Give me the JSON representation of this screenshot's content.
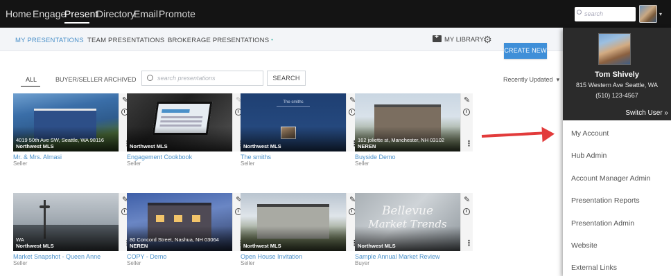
{
  "topnav": {
    "items": [
      {
        "label": "Home"
      },
      {
        "label": "Engage"
      },
      {
        "label": "Present"
      },
      {
        "label": "Directory"
      },
      {
        "label": "Email"
      },
      {
        "label": "Promote"
      }
    ],
    "active": "Present",
    "search_placeholder": "search"
  },
  "subnav": {
    "tabs": [
      {
        "label": "MY PRESENTATIONS"
      },
      {
        "label": "TEAM PRESENTATIONS"
      },
      {
        "label": "BROKERAGE PRESENTATIONS"
      }
    ],
    "new_dot": "•",
    "library_label": "MY LIBRARY",
    "create_label": "CREATE NEW"
  },
  "filters": {
    "tabs": [
      {
        "label": "ALL"
      },
      {
        "label": "BUYER/SELLER"
      },
      {
        "label": "ARCHIVED"
      }
    ],
    "search_placeholder": "search presentations",
    "search_button": "SEARCH",
    "sort_label": "Recently Updated",
    "sort_caret": "▾"
  },
  "cards": [
    {
      "title": "Mr. & Mrs. Almasi",
      "type": "Seller",
      "address": "4019 50th Ave SW, Seattle, WA 98116",
      "mls": "Northwest MLS"
    },
    {
      "title": "Engagement Cookbook",
      "type": "Seller",
      "address": "",
      "mls": "Northwest MLS"
    },
    {
      "title": "The smiths",
      "type": "Seller",
      "address": "",
      "mls": "Northwest MLS",
      "thumb_text": "The smiths"
    },
    {
      "title": "Buyside Demo",
      "type": "Seller",
      "address": "162 joliette st, Manchester, NH 03102",
      "mls": "NEREN"
    },
    {
      "title": "Market Snapshot - Queen Anne",
      "type": "Seller",
      "address": "WA",
      "mls": "Northwest MLS"
    },
    {
      "title": "COPY - Demo",
      "type": "Seller",
      "address": "80 Concord Street, Nashua, NH 03064",
      "mls": "NEREN"
    },
    {
      "title": "Open House Invitation",
      "type": "Seller",
      "address": "",
      "mls": "Northwest MLS"
    },
    {
      "title": "Sample Annual Market Review",
      "type": "Buyer",
      "address": "",
      "mls": "Northwest MLS",
      "thumb_line1": "Bellevue",
      "thumb_line2": "Market Trends"
    }
  ],
  "icons": {
    "pencil": "✎",
    "kebab": "⋮",
    "gear": "⚙",
    "caret": "▾"
  },
  "user_panel": {
    "name": "Tom Shively",
    "address": "815 Western Ave Seattle, WA",
    "phone": "(510) 123-4567",
    "switch_label": "Switch User »",
    "menu": [
      {
        "label": "My Account"
      },
      {
        "label": "Hub Admin"
      },
      {
        "label": "Account Manager Admin"
      },
      {
        "label": "Presentation Reports"
      },
      {
        "label": "Presentation Admin"
      },
      {
        "label": "Website"
      },
      {
        "label": "External Links"
      }
    ]
  },
  "colors": {
    "nav_bg": "#141414",
    "accent_blue": "#4a90c9",
    "create_button": "#3f8fd8",
    "annotation_arrow": "#e23b3b",
    "panel_header": "#2b2b2b"
  }
}
